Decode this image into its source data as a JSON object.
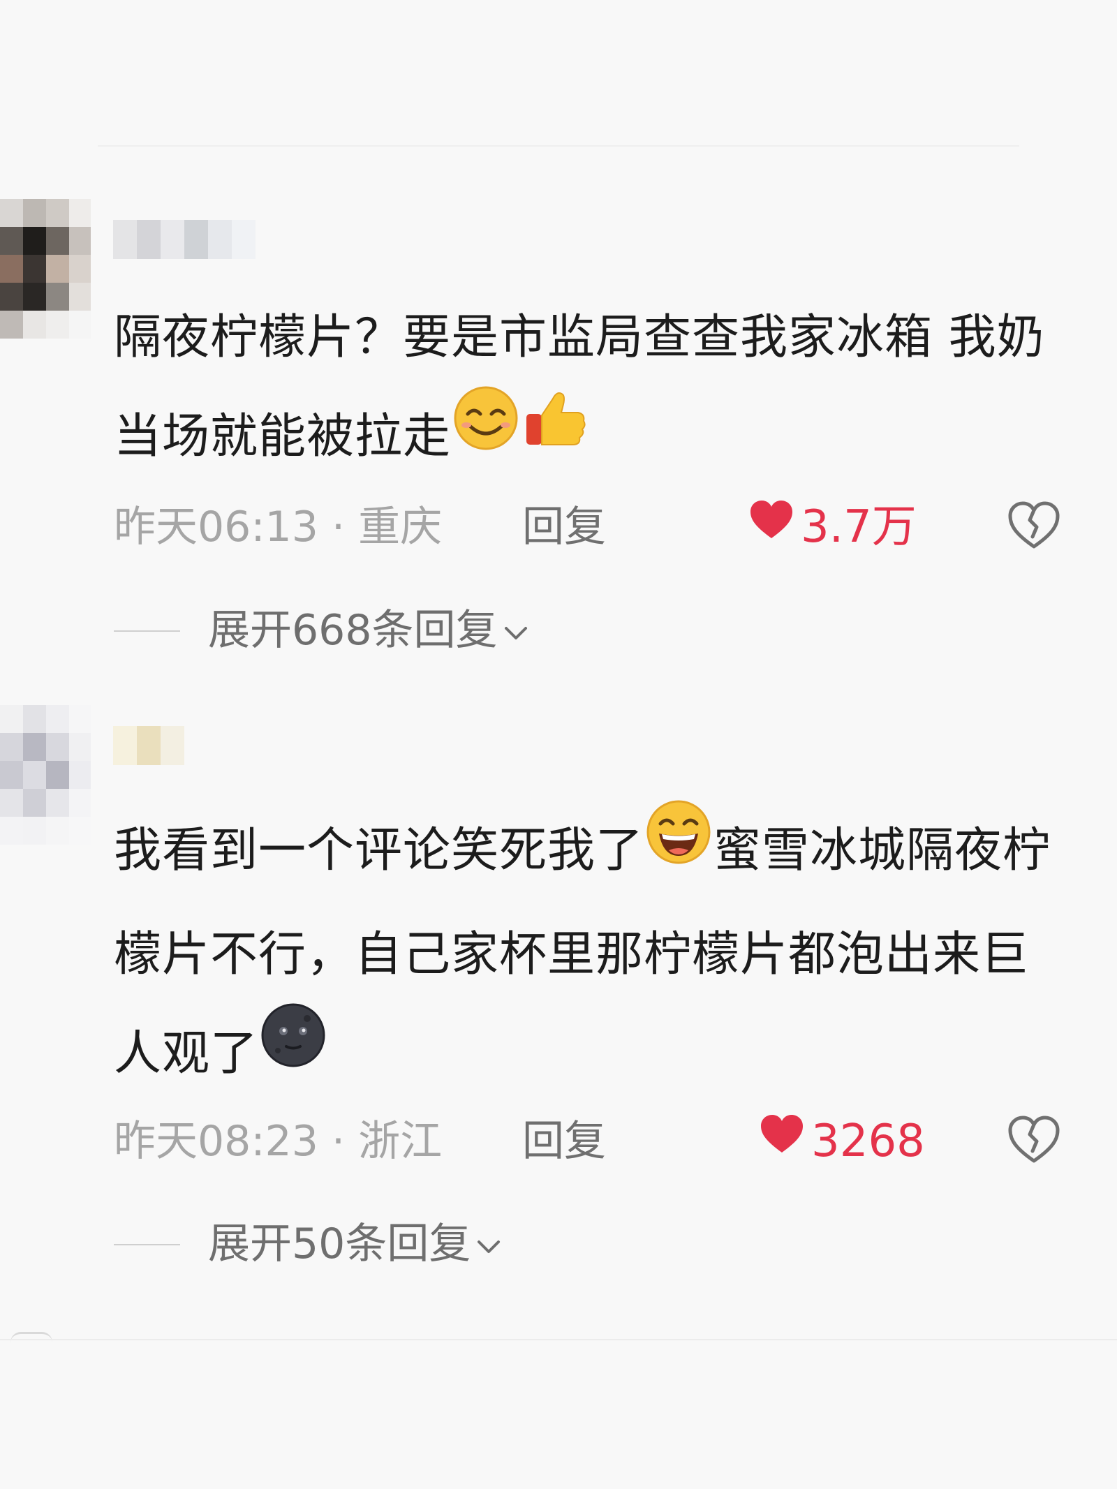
{
  "comments": [
    {
      "text_1": "隔夜柠檬片？要是市监局查查我家冰箱 我奶当场就能被拉走",
      "emojis": [
        "smiling-face-icon",
        "thumbs-up-icon"
      ],
      "time": "昨天06:13 · 重庆",
      "reply": "回复",
      "likes": "3.7万",
      "expand": "展开668条回复"
    },
    {
      "text_1": "我看到一个评论笑死我了",
      "text_2": "蜜雪冰城隔夜柠檬片不行，自己家杯里那柠檬片都泡出来巨人观了",
      "emojis": [
        "grinning-face-icon",
        "new-moon-face-icon"
      ],
      "time": "昨天08:23 · 浙江",
      "reply": "回复",
      "likes": "3268",
      "expand": "展开50条回复"
    }
  ],
  "colors": {
    "like": "#e4324a",
    "meta": "#a5a5a5",
    "text": "#1c1c1c",
    "background": "#f8f8f8"
  }
}
